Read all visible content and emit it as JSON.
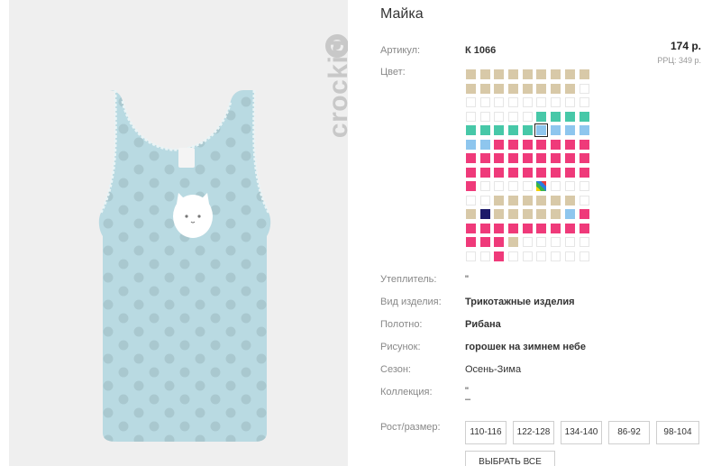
{
  "product": {
    "title": "Майка",
    "brand": "crockid",
    "article_label": "Артикул:",
    "article_value": "К 1066",
    "price": "174 р.",
    "rrp": "РРЦ: 349 р.",
    "color_label": "Цвет:"
  },
  "swatches": [
    "beige",
    "beige",
    "beige",
    "beige",
    "beige",
    "beige",
    "beige",
    "beige",
    "beige",
    "beige",
    "beige",
    "beige",
    "beige",
    "beige",
    "beige",
    "beige",
    "beige",
    "empty",
    "empty",
    "empty",
    "empty",
    "empty",
    "empty",
    "empty",
    "empty",
    "empty",
    "empty",
    "empty",
    "empty",
    "empty",
    "empty",
    "empty",
    "teal",
    "teal",
    "teal",
    "teal",
    "teal",
    "teal",
    "teal",
    "teal",
    "teal",
    "sky",
    "sky",
    "sky",
    "sky",
    "sky",
    "sky",
    "pink",
    "pink",
    "pink",
    "pink",
    "pink",
    "pink",
    "pink",
    "pink",
    "pink",
    "pink",
    "pink",
    "pink",
    "pink",
    "pink",
    "pink",
    "pink",
    "pink",
    "pink",
    "pink",
    "pink",
    "pink",
    "pink",
    "pink",
    "pink",
    "pink",
    "pink",
    "empty",
    "empty",
    "empty",
    "empty",
    "multi",
    "empty",
    "empty",
    "empty",
    "empty",
    "empty",
    "beige",
    "beige",
    "beige",
    "beige",
    "beige",
    "beige",
    "empty",
    "beige",
    "navy",
    "beige",
    "beige",
    "beige",
    "beige",
    "beige",
    "sky",
    "pink",
    "pink",
    "pink",
    "pink",
    "pink",
    "pink",
    "pink",
    "pink",
    "pink",
    "pink",
    "pink",
    "pink",
    "pink",
    "beige",
    "empty",
    "empty",
    "empty",
    "empty",
    "empty",
    "empty",
    "empty",
    "pink",
    "empty",
    "empty",
    "empty",
    "empty",
    "empty",
    "empty"
  ],
  "swatch_colors": {
    "beige": "#d8c9a8",
    "teal": "#47c8a8",
    "sky": "#8ec6ee",
    "pink": "#ef3a7a",
    "navy": "#1c1a6a"
  },
  "selected_swatch_index": 41,
  "attributes": {
    "insulation_label": "Утеплитель:",
    "insulation_value": "\"",
    "type_label": "Вид изделия:",
    "type_value": "Трикотажные изделия",
    "fabric_label": "Полотно:",
    "fabric_value": "Рибана",
    "pattern_label": "Рисунок:",
    "pattern_value": "горошек на зимнем небе",
    "season_label": "Сезон:",
    "season_value": "Осень-Зима",
    "collection_label": "Коллекция:",
    "collection_value_line1": "\"",
    "collection_value_line2": "–"
  },
  "sizes": {
    "label": "Рост/размер:",
    "options": [
      "110-116",
      "122-128",
      "134-140",
      "86-92",
      "98-104"
    ],
    "select_all": "Выбрать все"
  }
}
